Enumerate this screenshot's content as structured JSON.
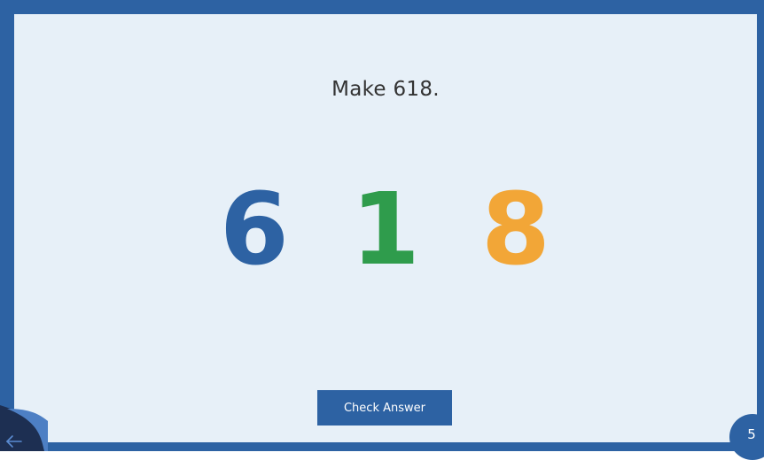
{
  "prompt": "Make 618.",
  "digits": [
    {
      "value": "6",
      "color": "#2d62a3"
    },
    {
      "value": "1",
      "color": "#2f9c4c"
    },
    {
      "value": "8",
      "color": "#f2a637"
    }
  ],
  "check_button_label": "Check Answer",
  "page_number": "5",
  "colors": {
    "frame": "#2d62a3",
    "panel": "#e7f0f8",
    "button": "#2d62a3"
  },
  "icons": {
    "back": "back-arrow-icon"
  }
}
